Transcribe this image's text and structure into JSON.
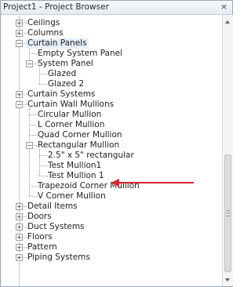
{
  "window": {
    "title": "Project1 - Project Browser",
    "close_symbol": "×"
  },
  "tree": {
    "items": [
      {
        "label": "Ceilings",
        "depth": 0,
        "expander": "+"
      },
      {
        "label": "Columns",
        "depth": 0,
        "expander": "+"
      },
      {
        "label": "Curtain Panels",
        "depth": 0,
        "expander": "-",
        "selected": true
      },
      {
        "label": "Empty System Panel",
        "depth": 1,
        "expander": ""
      },
      {
        "label": "System Panel",
        "depth": 1,
        "expander": "-"
      },
      {
        "label": "Glazed",
        "depth": 2,
        "expander": ""
      },
      {
        "label": "Glazed 2",
        "depth": 2,
        "expander": ""
      },
      {
        "label": "Curtain Systems",
        "depth": 0,
        "expander": "+"
      },
      {
        "label": "Curtain Wall Mullions",
        "depth": 0,
        "expander": "-"
      },
      {
        "label": "Circular Mullion",
        "depth": 1,
        "expander": ""
      },
      {
        "label": "L Corner Mullion",
        "depth": 1,
        "expander": ""
      },
      {
        "label": "Quad Corner Mullion",
        "depth": 1,
        "expander": ""
      },
      {
        "label": "Rectangular Mullion",
        "depth": 1,
        "expander": "-"
      },
      {
        "label": "2.5\" x 5\" rectangular",
        "depth": 2,
        "expander": ""
      },
      {
        "label": "Test Mullion1",
        "depth": 2,
        "expander": ""
      },
      {
        "label": "Test Mullion 1",
        "depth": 2,
        "expander": ""
      },
      {
        "label": "Trapezoid Corner Mullion",
        "depth": 1,
        "expander": ""
      },
      {
        "label": "V Corner Mullion",
        "depth": 1,
        "expander": ""
      },
      {
        "label": "Detail Items",
        "depth": 0,
        "expander": "+"
      },
      {
        "label": "Doors",
        "depth": 0,
        "expander": "+"
      },
      {
        "label": "Duct Systems",
        "depth": 0,
        "expander": "+"
      },
      {
        "label": "Floors",
        "depth": 0,
        "expander": "+"
      },
      {
        "label": "Pattern",
        "depth": 0,
        "expander": "+"
      },
      {
        "label": "Piping Systems",
        "depth": 0,
        "expander": "+"
      }
    ]
  },
  "annotation": {
    "color": "#d9262b"
  },
  "icons": {
    "scroll_up": "scroll-up-icon",
    "scroll_down": "scroll-down-icon",
    "close": "close-icon"
  }
}
